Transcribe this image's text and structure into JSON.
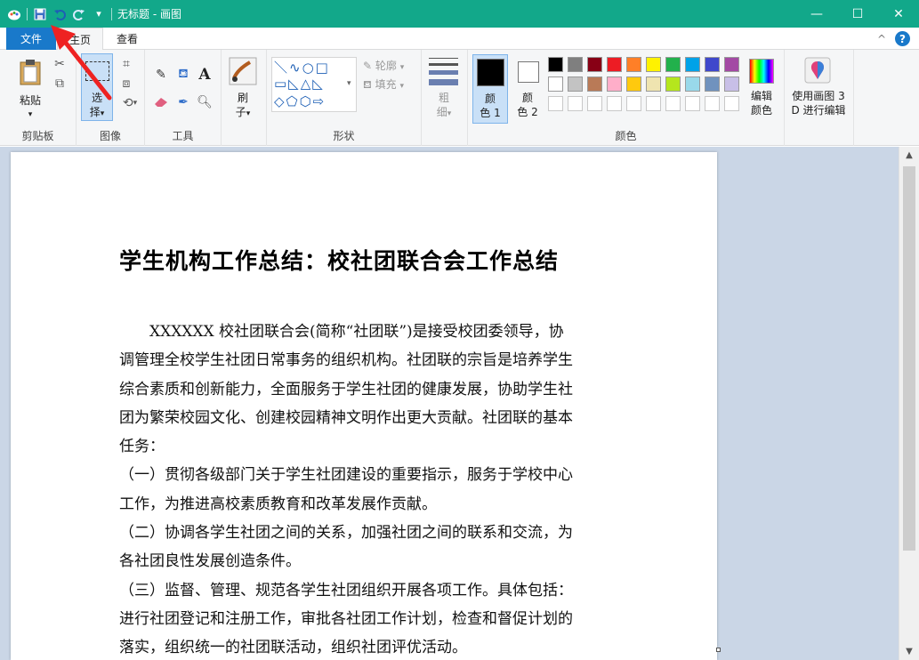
{
  "window": {
    "title": "无标题 - 画图",
    "controls": {
      "minimize": "—",
      "maximize": "☐",
      "close": "✕"
    }
  },
  "qat": {
    "icons": [
      "paint-app-icon",
      "save-icon",
      "undo-icon",
      "redo-icon",
      "customize-qat-icon"
    ],
    "customize_glyph": "▾"
  },
  "tabs": {
    "file": "文件",
    "home": "主页",
    "view": "查看"
  },
  "tabbar_right": {
    "collapse": "^",
    "help": "?"
  },
  "ribbon": {
    "clipboard": {
      "label": "剪贴板",
      "paste": "粘贴",
      "paste_arrow": "▾"
    },
    "image": {
      "label": "图像",
      "select_top": "选",
      "select_bottom": "择",
      "select_arrow": "▾",
      "rotate_arrow": "▾"
    },
    "tools": {
      "label": "工具",
      "text_tool": "A"
    },
    "brushes": {
      "label_top": "刷",
      "label_bottom": "子",
      "arrow": "▾"
    },
    "shapes": {
      "label": "形状",
      "outline": "轮廓",
      "fill": "填充",
      "dropdown": "▾",
      "glyphs_row1": "＼∿○□",
      "glyphs_row2": "▭◺△◺",
      "glyphs_row3": "◇⬠⬡⇨"
    },
    "size": {
      "label_top": "粗",
      "label_bottom": "细",
      "arrow": "▾"
    },
    "colors": {
      "label": "颜色",
      "color1_top": "颜",
      "color1_bottom": "色 1",
      "color2_top": "颜",
      "color2_bottom": "色 2",
      "edit_top": "编辑",
      "edit_bottom": "颜色",
      "color1_value": "#000000",
      "color2_value": "#ffffff",
      "palette_row1": [
        "#000000",
        "#7f7f7f",
        "#880015",
        "#ed1c24",
        "#ff7f27",
        "#fff200",
        "#22b14c",
        "#00a2e8",
        "#3f48cc",
        "#a349a4"
      ],
      "palette_row2": [
        "#ffffff",
        "#c3c3c3",
        "#b97a57",
        "#ffaec9",
        "#ffc90e",
        "#efe4b0",
        "#b5e61d",
        "#99d9ea",
        "#7092be",
        "#c8bfe7"
      ]
    },
    "paint3d": {
      "line1": "使用画图 3",
      "line2": "D 进行编辑"
    }
  },
  "document": {
    "title": "学生机构工作总结：校社团联合会工作总结",
    "lines": [
      "　　XXXXXX 校社团联合会(简称“社团联”)是接受校团委领导，协",
      "调管理全校学生社团日常事务的组织机构。社团联的宗旨是培养学生",
      "综合素质和创新能力，全面服务于学生社团的健康发展，协助学生社",
      "团为繁荣校园文化、创建校园精神文明作出更大贡献。社团联的基本",
      "任务：",
      "（一）贯彻各级部门关于学生社团建设的重要指示，服务于学校中心",
      "工作，为推进高校素质教育和改革发展作贡献。",
      "（二）协调各学生社团之间的关系，加强社团之间的联系和交流，为",
      "各社团良性发展创造条件。",
      "（三）监督、管理、规范各学生社团组织开展各项工作。具体包括：",
      "进行社团登记和注册工作，审批各社团工作计划，检查和督促计划的",
      "落实，组织统一的社团联活动，组织社团评优活动。"
    ]
  },
  "scrollbar": {
    "up": "▲",
    "down": "▼"
  }
}
